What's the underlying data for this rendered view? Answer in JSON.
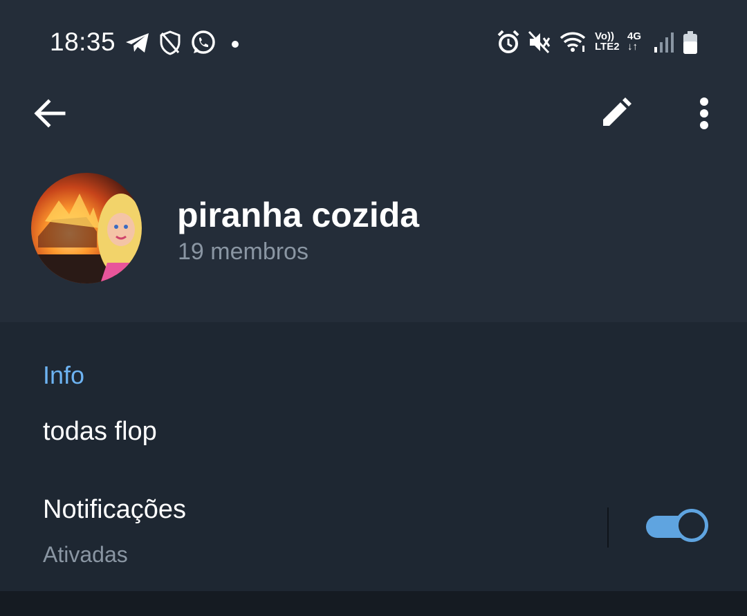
{
  "statusbar": {
    "time": "18:35",
    "left_icons": [
      "telegram-icon",
      "shield-icon",
      "whatsapp-icon",
      "dot-icon"
    ],
    "right_icons": [
      "alarm-icon",
      "mute-icon",
      "wifi-icon",
      "volte-icon",
      "4g-icon",
      "signal-icon",
      "battery-icon"
    ],
    "volte_top": "Vo))",
    "volte_bottom": "LTE2",
    "network_top": "4G",
    "network_bottom": "↓↑"
  },
  "topbar": {
    "back_icon": "arrow-left-icon",
    "edit_icon": "pencil-icon",
    "menu_icon": "more-vertical-icon"
  },
  "profile": {
    "name": "piranha cozida",
    "members": "19 membros"
  },
  "info": {
    "title": "Info",
    "description": "todas flop",
    "notifications_label": "Notificações",
    "notifications_status": "Ativadas",
    "notifications_on": true
  },
  "colors": {
    "header_bg": "#242d39",
    "section_bg": "#1e2732",
    "accent": "#6db3f2",
    "toggle": "#5fa4e0",
    "secondary_text": "#8a96a3"
  }
}
